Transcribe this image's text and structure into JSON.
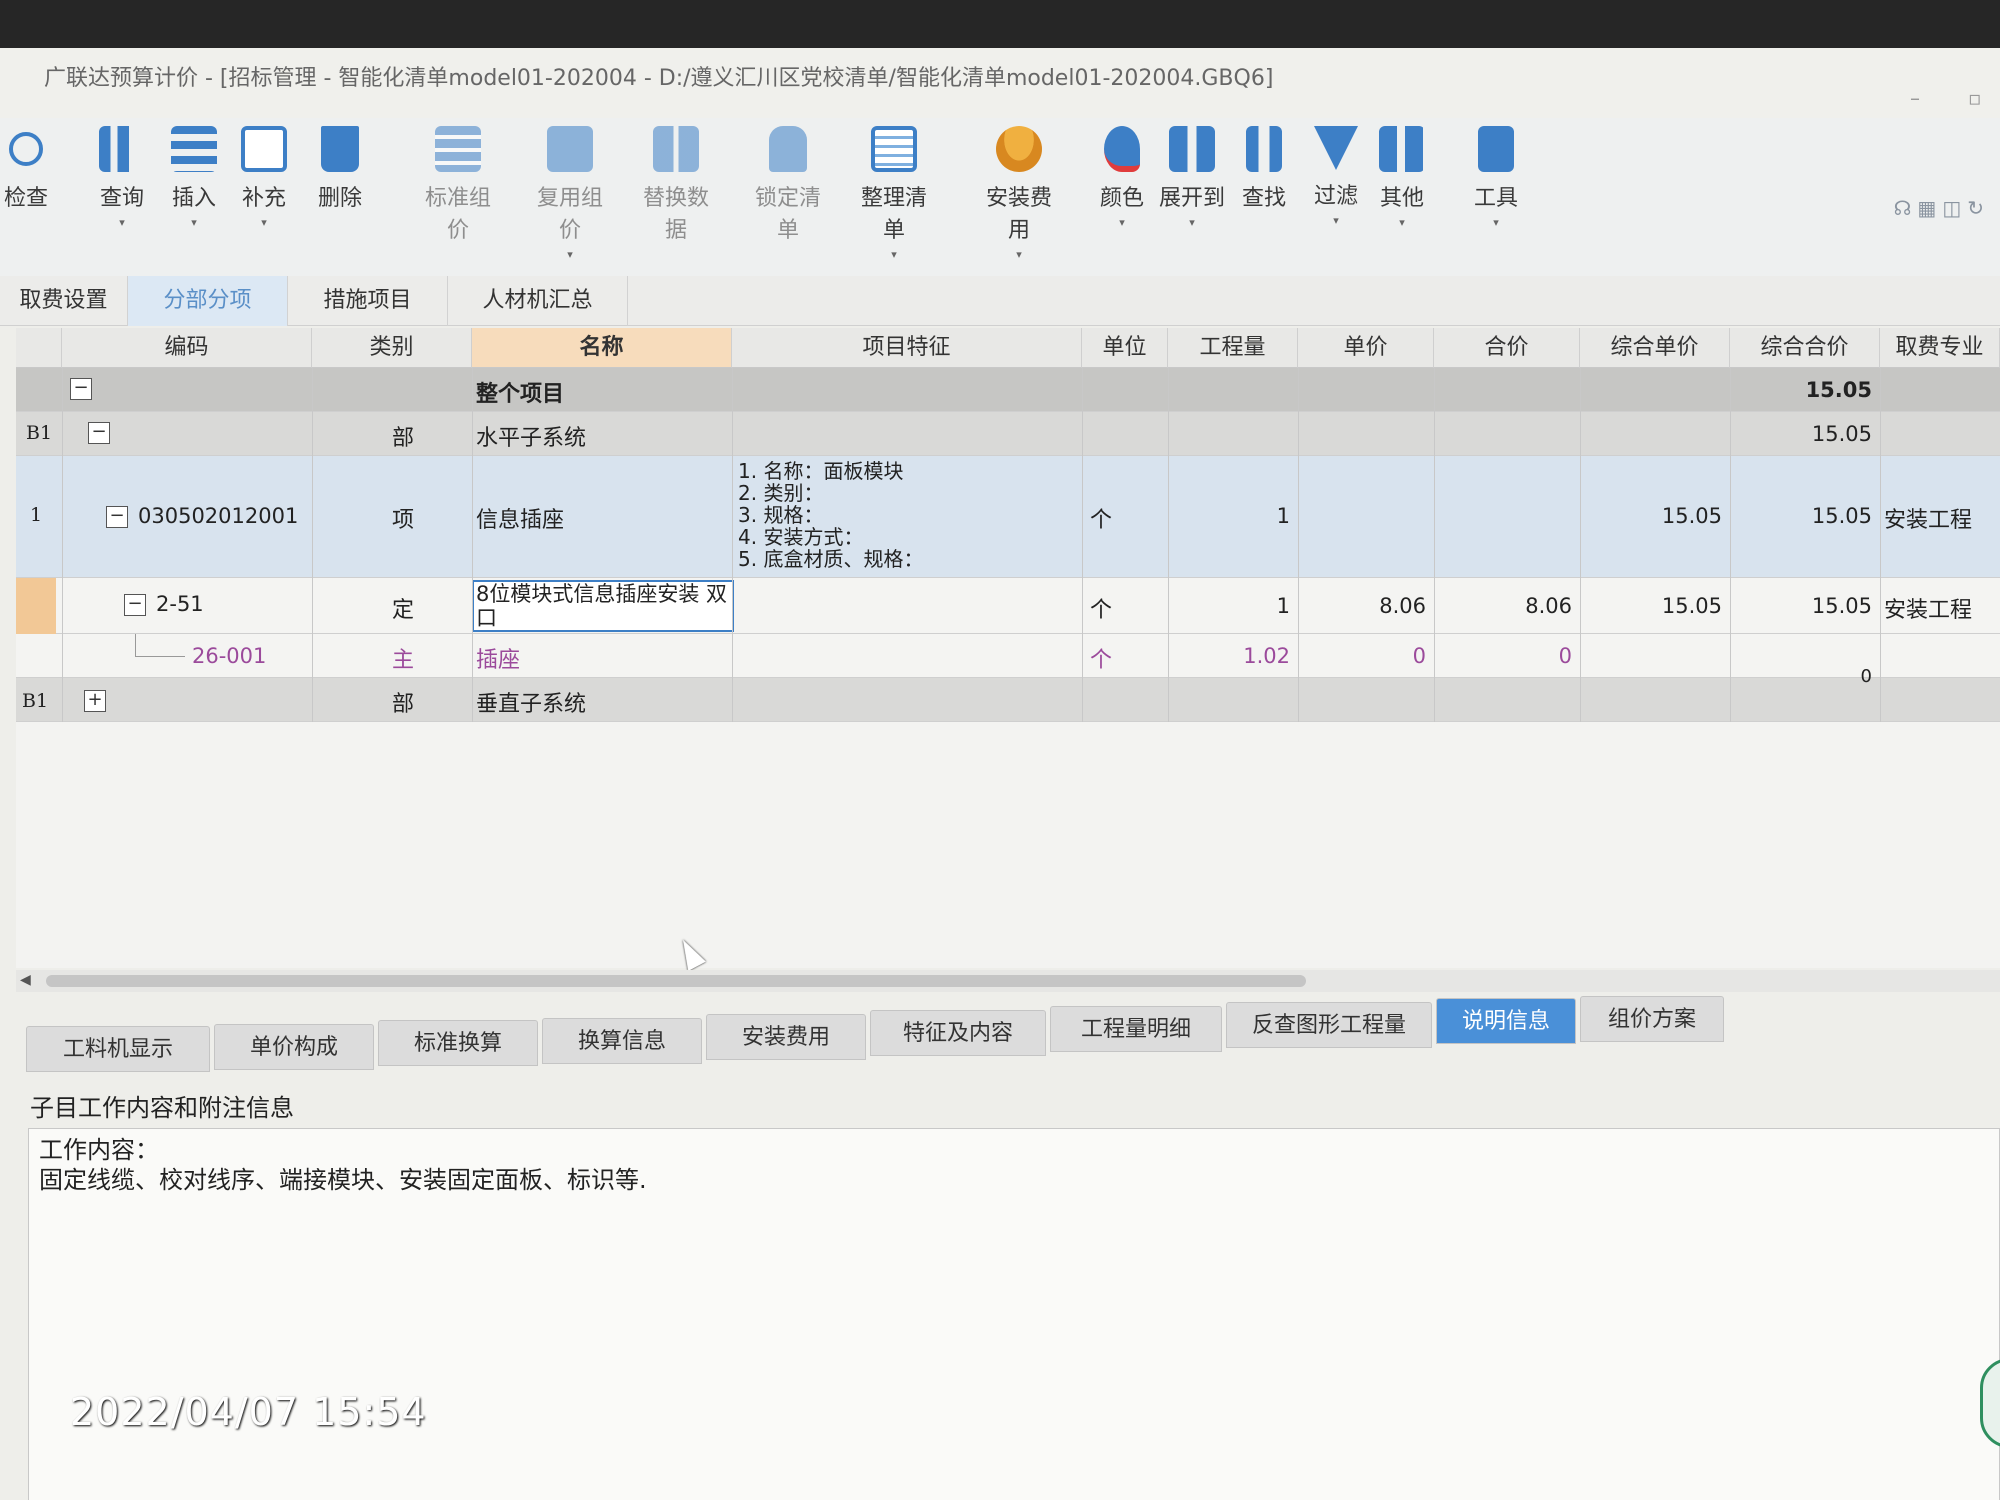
{
  "window": {
    "title": "广联达预算计价 - [招标管理 - 智能化清单model01-202004 - D:/遵义汇川区党校清单/智能化清单model01-202004.GBQ6]",
    "minimize": "–",
    "restore": "▫"
  },
  "toolbar": [
    {
      "label": "检查",
      "icon": "check-icon"
    },
    {
      "label": "查询",
      "icon": "query-icon"
    },
    {
      "label": "插入",
      "icon": "insert-icon"
    },
    {
      "label": "补充",
      "icon": "supplement-icon"
    },
    {
      "label": "删除",
      "icon": "delete-icon"
    },
    {
      "label": "标准组价",
      "icon": "standard-pricing-icon"
    },
    {
      "label": "复用组价",
      "icon": "reuse-pricing-icon"
    },
    {
      "label": "替换数据",
      "icon": "replace-data-icon"
    },
    {
      "label": "锁定清单",
      "icon": "lock-icon"
    },
    {
      "label": "整理清单",
      "icon": "organize-list-icon"
    },
    {
      "label": "安装费用",
      "icon": "install-fee-icon"
    },
    {
      "label": "颜色",
      "icon": "color-icon"
    },
    {
      "label": "展开到",
      "icon": "expand-icon"
    },
    {
      "label": "查找",
      "icon": "find-icon"
    },
    {
      "label": "过滤",
      "icon": "filter-icon"
    },
    {
      "label": "其他",
      "icon": "other-icon"
    },
    {
      "label": "工具",
      "icon": "tools-icon"
    }
  ],
  "tabs": [
    {
      "label": "取费设置"
    },
    {
      "label": "分部分项"
    },
    {
      "label": "措施项目"
    },
    {
      "label": "人材机汇总"
    }
  ],
  "table": {
    "headers": [
      "编码",
      "类别",
      "名称",
      "项目特征",
      "单位",
      "工程量",
      "单价",
      "合价",
      "综合单价",
      "综合合价",
      "取费专业"
    ],
    "rows": [
      {
        "code": "",
        "type": "",
        "name": "整个项目",
        "feature": "",
        "unit": "",
        "qty": "",
        "price": "",
        "total": "",
        "comp_price": "",
        "comp_total": "15.05",
        "fee": ""
      },
      {
        "idx": "B1",
        "code": "",
        "type": "部",
        "name": "水平子系统",
        "comp_total": "15.05"
      },
      {
        "idx": "1",
        "code": "030502012001",
        "type": "项",
        "name": "信息插座",
        "features": [
          "1. 名称：面板模块",
          "2. 类别：",
          "3. 规格：",
          "4. 安装方式：",
          "5. 底盒材质、规格："
        ],
        "unit": "个",
        "qty": "1",
        "comp_price": "15.05",
        "comp_total": "15.05",
        "fee": "安装工程"
      },
      {
        "code": "2-51",
        "type": "定",
        "name": "8位模块式信息插座安装 双口",
        "unit": "个",
        "qty": "1",
        "price": "8.06",
        "total": "8.06",
        "comp_price": "15.05",
        "comp_total": "15.05",
        "fee": "安装工程"
      },
      {
        "code": "26-001",
        "type": "主",
        "name": "插座",
        "unit": "个",
        "qty": "1.02",
        "price": "0",
        "total": "0"
      },
      {
        "idx": "B1",
        "type": "部",
        "name": "垂直子系统",
        "comp_total": "0"
      }
    ]
  },
  "bottom_tabs": [
    "工料机显示",
    "单价构成",
    "标准换算",
    "换算信息",
    "安装费用",
    "特征及内容",
    "工程量明细",
    "反查图形工程量",
    "说明信息",
    "组价方案"
  ],
  "notes": {
    "title": "子目工作内容和附注信息",
    "line1": "工作内容：",
    "line2": "固定线缆、校对线序、端接模块、安装固定面板、标识等."
  },
  "photo": {
    "timestamp": "2022/04/07 15:54"
  },
  "colors": {
    "active_tab": "#4a90d8",
    "selected_header": "#f7dcbc",
    "row_highlight": "#d8e3ee",
    "material_text": "#9b4a9b"
  }
}
